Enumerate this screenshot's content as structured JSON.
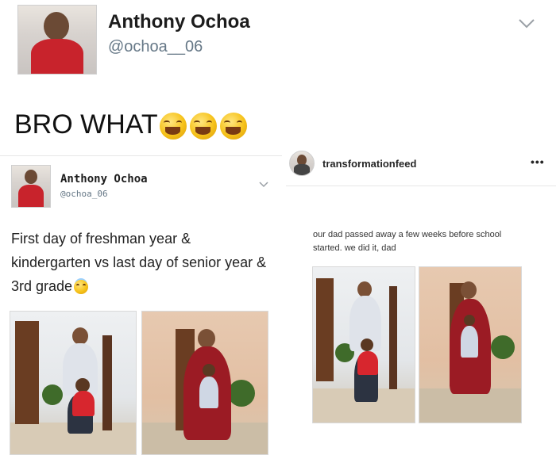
{
  "top_tweet": {
    "display_name": "Anthony Ochoa",
    "handle": "@ochoa__06",
    "text": "BRO WHAT",
    "emoji": [
      "joy-emoji",
      "joy-emoji",
      "joy-emoji"
    ]
  },
  "embedded_tweet": {
    "display_name": "Anthony Ochoa",
    "handle": "@ochoa_06",
    "text": "First day of freshman year & kindergarten vs last day of senior year & 3rd grade",
    "emoji": "innocent-emoji"
  },
  "instagram_post": {
    "account": "transformationfeed",
    "caption": "our dad passed away a few weeks before school started. we did it, dad"
  },
  "colors": {
    "text": "#1c1c1c",
    "handle": "#657786",
    "chevron": "#9aa0a6",
    "emoji": "#f6c21a"
  }
}
